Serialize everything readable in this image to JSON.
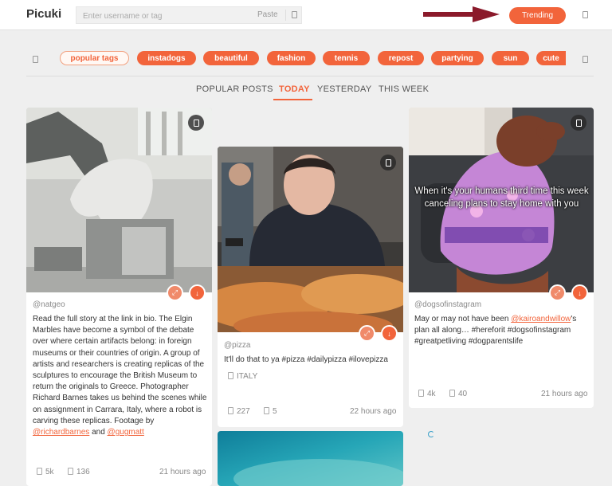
{
  "header": {
    "logo": "Picuki",
    "search": {
      "placeholder": "Enter username or tag",
      "paste_label": "Paste"
    },
    "trending_label": "Trending"
  },
  "tags": [
    "popular tags",
    "instadogs",
    "beautiful",
    "fashion",
    "tennis",
    "repost",
    "partying",
    "sun",
    "cute"
  ],
  "tabs": [
    "POPULAR POSTS",
    "TODAY",
    "YESTERDAY",
    "THIS WEEK"
  ],
  "active_tab": "TODAY",
  "posts": [
    {
      "username": "@natgeo",
      "caption_before": "Read the full story at the link in bio. The Elgin Marbles have become a symbol of the debate over where certain artifacts belong: in foreign museums or their countries of origin. A group of artists and researchers is creating replicas of the sculptures to encourage the British Museum to return the originals to Greece. Photographer Richard Barnes takes us behind the scenes while on assignment in Carrara, Italy, where a robot is carving these replicas. Footage by",
      "mention1": "@richardbarnes",
      "and": "and",
      "mention2": "@gugmatt",
      "likes": "5k",
      "comments": "136",
      "time": "21 hours ago"
    },
    {
      "username": "@pizza",
      "caption": "It'll do that to ya #pizza #dailypizza #ilovepizza",
      "location": "ITALY",
      "likes": "227",
      "comments": "5",
      "time": "22 hours ago"
    },
    {
      "username": "@dogsofinstagram",
      "overlay_text": "When it's your humans third time this week canceling plans to stay home with you",
      "caption_before": "May or may not have been",
      "mention": "@kairoandwillow",
      "caption_after": "'s plan all along… #hereforit #dogsofinstagram #greatpetliving #dogparentslife",
      "likes": "4k",
      "comments": "40",
      "time": "21 hours ago"
    }
  ],
  "colors": {
    "accent": "#f2643b",
    "arrow": "#8b1a2b"
  }
}
